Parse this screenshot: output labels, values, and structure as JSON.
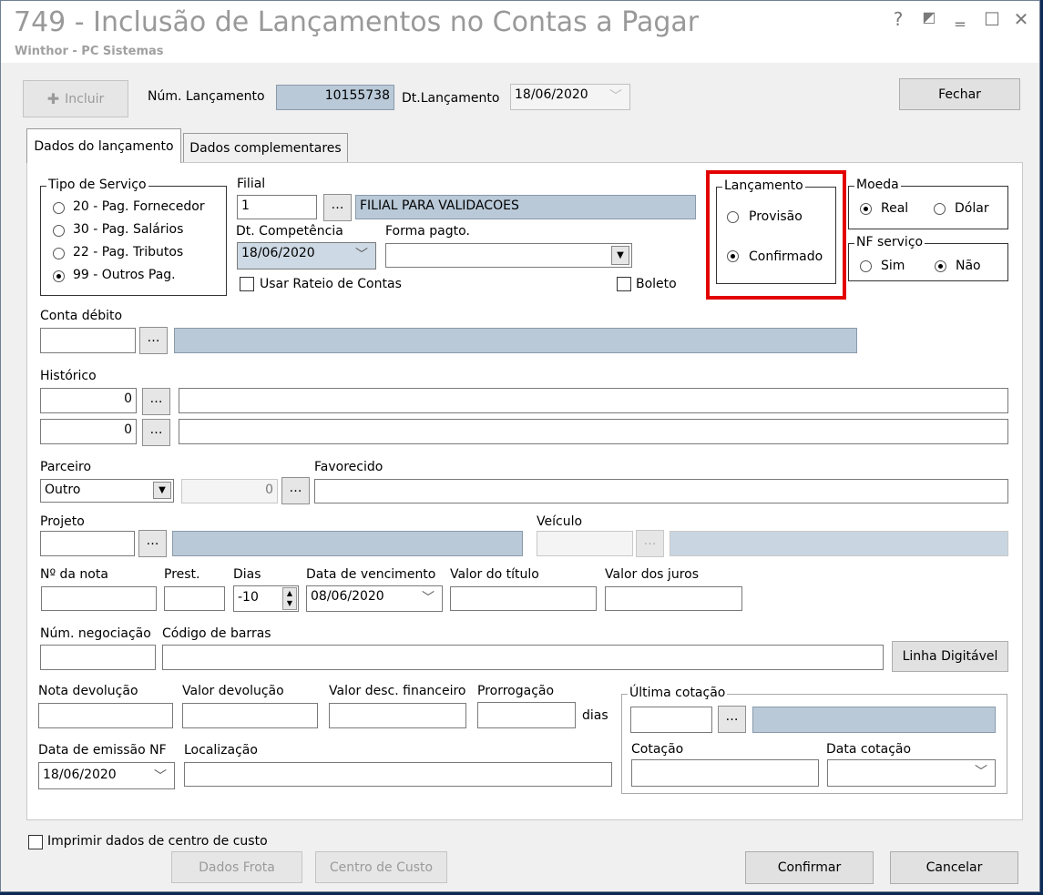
{
  "window": {
    "title": "749 - Inclusão de Lançamentos no Contas a Pagar",
    "subtitle": "Winthor - PC Sistemas",
    "buttons": {
      "help": "?",
      "restore": "◩",
      "minimize": "‗",
      "maximize": "☐",
      "close": "✕"
    }
  },
  "toolbar": {
    "incluir_label": "Incluir",
    "num_lancamento_label": "Núm. Lançamento",
    "num_lancamento_value": "10155738",
    "dt_lancamento_label": "Dt.Lançamento",
    "dt_lancamento_value": "18/06/2020",
    "fechar_label": "Fechar"
  },
  "tabs": [
    {
      "label": "Dados do lançamento",
      "active": true
    },
    {
      "label": "Dados complementares",
      "active": false
    }
  ],
  "tipo_servico": {
    "legend": "Tipo de Serviço",
    "options": [
      {
        "label": "20 - Pag. Fornecedor",
        "selected": false
      },
      {
        "label": "30 - Pag. Salários",
        "selected": false
      },
      {
        "label": "22 - Pag. Tributos",
        "selected": false
      },
      {
        "label": "99 - Outros Pag.",
        "selected": true
      }
    ]
  },
  "filial": {
    "label": "Filial",
    "code": "1",
    "name": "FILIAL PARA VALIDACOES"
  },
  "dt_competencia": {
    "label": "Dt. Competência",
    "value": "18/06/2020"
  },
  "forma_pagto": {
    "label": "Forma pagto.",
    "value": ""
  },
  "usar_rateio": {
    "label": "Usar Rateio de Contas",
    "checked": false
  },
  "boleto": {
    "label": "Boleto",
    "checked": false
  },
  "lancamento": {
    "legend": "Lançamento",
    "options": [
      {
        "label": "Provisão",
        "selected": false
      },
      {
        "label": "Confirmado",
        "selected": true
      }
    ]
  },
  "moeda": {
    "legend": "Moeda",
    "options": [
      {
        "label": "Real",
        "selected": true
      },
      {
        "label": "Dólar",
        "selected": false
      }
    ]
  },
  "nf_servico": {
    "legend": "NF serviço",
    "options": [
      {
        "label": "Sim",
        "selected": false
      },
      {
        "label": "Não",
        "selected": true
      }
    ]
  },
  "conta_debito": {
    "label": "Conta débito",
    "code": "",
    "name": ""
  },
  "historico": {
    "label": "Histórico",
    "code1": "0",
    "text1": "",
    "code2": "0",
    "text2": ""
  },
  "parceiro": {
    "label": "Parceiro",
    "value": "Outro",
    "code": "0"
  },
  "favorecido": {
    "label": "Favorecido",
    "value": ""
  },
  "projeto": {
    "label": "Projeto",
    "code": "",
    "name": ""
  },
  "veiculo": {
    "label": "Veículo",
    "code": "",
    "name": ""
  },
  "nota": {
    "num_nota_label": "Nº da nota",
    "num_nota_value": "",
    "prest_label": "Prest.",
    "prest_value": "",
    "dias_label": "Dias",
    "dias_value": "-10",
    "vencimento_label": "Data de vencimento",
    "vencimento_value": "08/06/2020",
    "valor_titulo_label": "Valor do título",
    "valor_titulo_value": "",
    "valor_juros_label": "Valor dos juros",
    "valor_juros_value": ""
  },
  "negociacao": {
    "num_label": "Núm. negociação",
    "num_value": "",
    "barras_label": "Código de barras",
    "barras_value": "",
    "linha_digitavel_label": "Linha Digitável"
  },
  "devolucao": {
    "nota_label": "Nota devolução",
    "nota_value": "",
    "valor_label": "Valor devolução",
    "valor_value": "",
    "desc_fin_label": "Valor desc. financeiro",
    "desc_fin_value": "",
    "prorrogacao_label": "Prorrogação",
    "prorrogacao_value": "",
    "dias_label": "dias"
  },
  "emissao": {
    "data_label": "Data de emissão NF",
    "data_value": "18/06/2020",
    "localizacao_label": "Localização",
    "localizacao_value": ""
  },
  "ultima_cotacao": {
    "legend": "Última cotação",
    "code": "",
    "name": "",
    "cotacao_label": "Cotação",
    "cotacao_value": "",
    "data_label": "Data cotação",
    "data_value": ""
  },
  "footer": {
    "imprimir_label": "Imprimir dados de centro de custo",
    "imprimir_checked": false,
    "dados_frota_label": "Dados Frota",
    "centro_custo_label": "Centro de Custo",
    "confirmar_label": "Confirmar",
    "cancelar_label": "Cancelar"
  },
  "icons": {
    "plus": "plus-icon",
    "dropdown": "chevron-down-icon",
    "ellipsis": "ellipsis-icon",
    "spin": "spin-icon"
  },
  "colors": {
    "readonly_field": "#b9c9d8",
    "highlight": "#e30000",
    "window_bg": "#f0f0f0"
  }
}
